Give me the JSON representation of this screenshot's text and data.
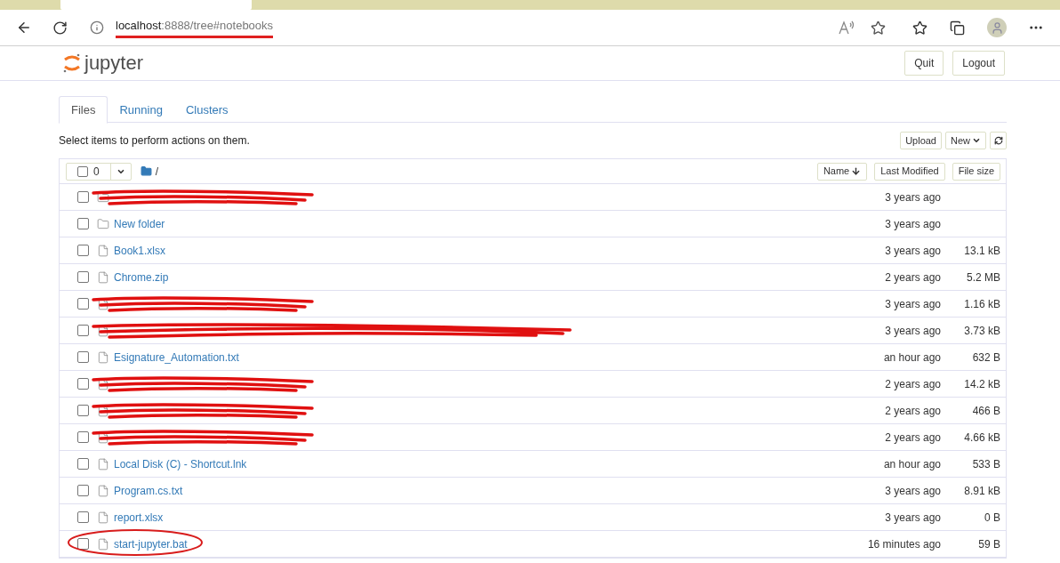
{
  "browser": {
    "address": {
      "host": "localhost",
      "rest": ":8888/tree#notebooks",
      "underlined": true
    }
  },
  "header": {
    "logo": "jupyter",
    "buttons": [
      "Quit",
      "Logout"
    ]
  },
  "tabs": [
    {
      "label": "Files",
      "selected": true
    },
    {
      "label": "Running",
      "selected": false
    },
    {
      "label": "Clusters",
      "selected": false
    }
  ],
  "hint": "Select items to perform actions on them.",
  "toolbar": {
    "buttons": [
      "Upload",
      "New"
    ]
  },
  "list_header": {
    "count": "0",
    "path": "/",
    "columns": [
      "Name",
      "Last Modified",
      "File size"
    ]
  },
  "rows": [
    {
      "kind": "folder",
      "name": "",
      "redacted": true,
      "circled": false,
      "checked": false,
      "modified": "3 years ago",
      "size": ""
    },
    {
      "kind": "folder",
      "name": "New folder",
      "redacted": false,
      "circled": false,
      "checked": false,
      "modified": "3 years ago",
      "size": ""
    },
    {
      "kind": "file",
      "name": "Book1.xlsx",
      "redacted": false,
      "circled": false,
      "checked": false,
      "modified": "3 years ago",
      "size": "13.1 kB"
    },
    {
      "kind": "file",
      "name": "Chrome.zip",
      "redacted": false,
      "circled": false,
      "checked": false,
      "modified": "2 years ago",
      "size": "5.2 MB"
    },
    {
      "kind": "file",
      "name": "",
      "redacted": true,
      "circled": false,
      "checked": false,
      "modified": "3 years ago",
      "size": "1.16 kB"
    },
    {
      "kind": "file",
      "name": "",
      "redacted": true,
      "circled": false,
      "checked": false,
      "modified": "3 years ago",
      "size": "3.73 kB"
    },
    {
      "kind": "file",
      "name": "Esignature_Automation.txt",
      "redacted": false,
      "circled": false,
      "checked": false,
      "modified": "an hour ago",
      "size": "632 B"
    },
    {
      "kind": "file",
      "name": "",
      "redacted": true,
      "circled": false,
      "checked": false,
      "modified": "2 years ago",
      "size": "14.2 kB"
    },
    {
      "kind": "file",
      "name": "",
      "redacted": true,
      "circled": false,
      "checked": false,
      "modified": "2 years ago",
      "size": "466 B"
    },
    {
      "kind": "file",
      "name": "",
      "redacted": true,
      "circled": false,
      "checked": false,
      "modified": "2 years ago",
      "size": "4.66 kB"
    },
    {
      "kind": "file",
      "name": "Local Disk (C) - Shortcut.lnk",
      "redacted": false,
      "circled": false,
      "checked": false,
      "modified": "an hour ago",
      "size": "533 B"
    },
    {
      "kind": "file",
      "name": "Program.cs.txt",
      "redacted": false,
      "circled": false,
      "checked": false,
      "modified": "3 years ago",
      "size": "8.91 kB"
    },
    {
      "kind": "file",
      "name": "report.xlsx",
      "redacted": false,
      "circled": false,
      "checked": false,
      "modified": "3 years ago",
      "size": "0 B"
    },
    {
      "kind": "file",
      "name": "start-jupyter.bat",
      "redacted": false,
      "circled": true,
      "checked": false,
      "modified": "16 minutes ago",
      "size": "59 B"
    }
  ]
}
